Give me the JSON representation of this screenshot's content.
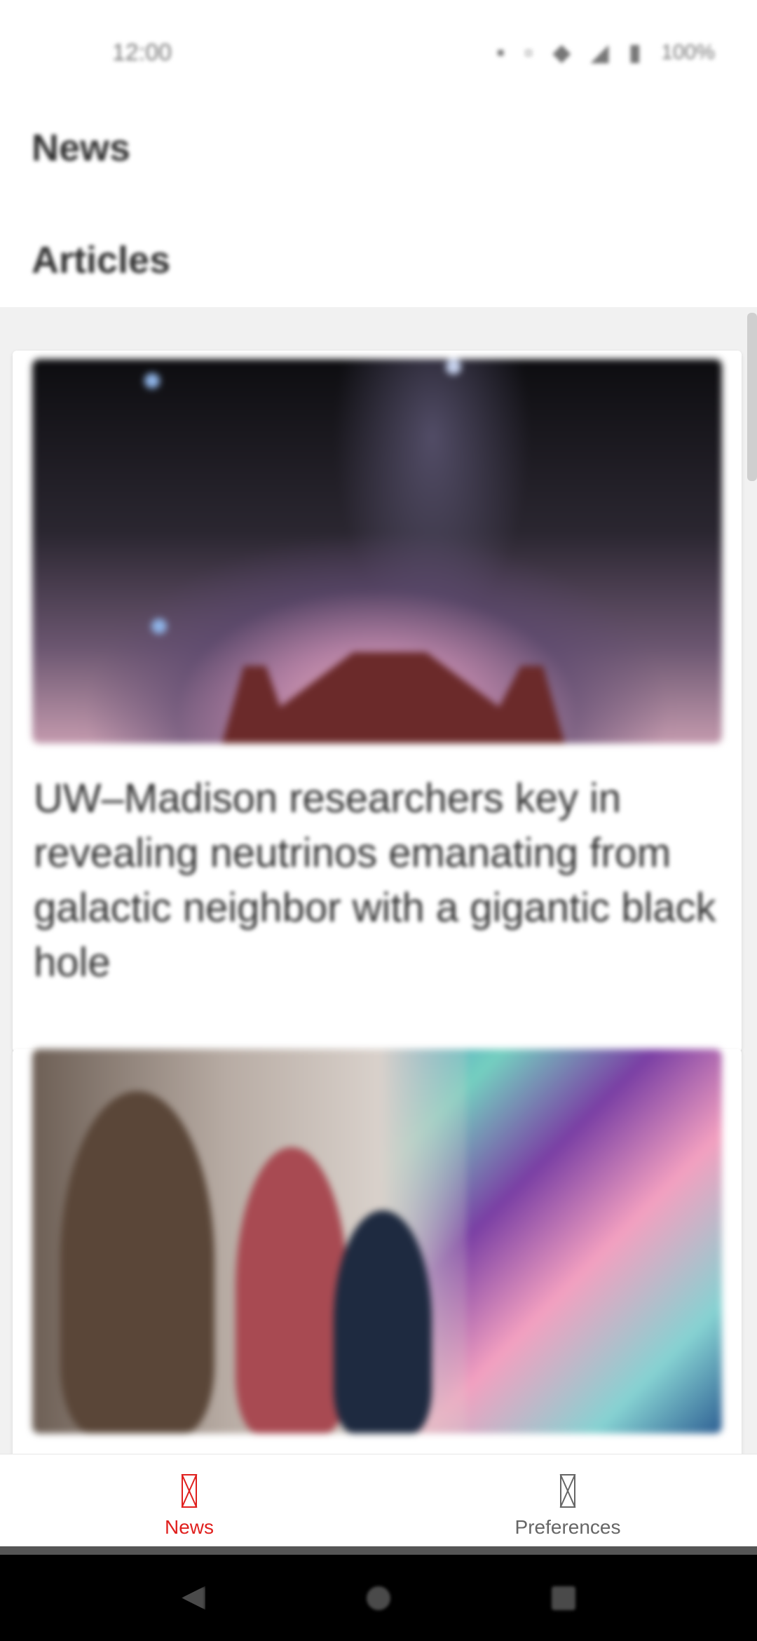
{
  "status_bar": {
    "time": "12:00",
    "battery": "100%",
    "icons": [
      "notification-icon",
      "notification-icon",
      "wifi-icon",
      "signal-icon",
      "battery-icon"
    ]
  },
  "header": {
    "title": "News",
    "section": "Articles"
  },
  "articles": [
    {
      "title": "UW–Madison researchers key in revealing neutrinos emanating from galactic neighbor with a gigantic black hole",
      "image": "galaxy-telescope-image"
    },
    {
      "title": "",
      "image": "mural-painting-image"
    }
  ],
  "bottom_nav": {
    "items": [
      {
        "label": "News",
        "active": true,
        "icon": "news-icon"
      },
      {
        "label": "Preferences",
        "active": false,
        "icon": "preferences-icon"
      }
    ],
    "active_color": "#e0201e",
    "inactive_color": "#666666"
  },
  "system_nav": {
    "buttons": [
      "back-button",
      "home-button",
      "recents-button"
    ]
  }
}
